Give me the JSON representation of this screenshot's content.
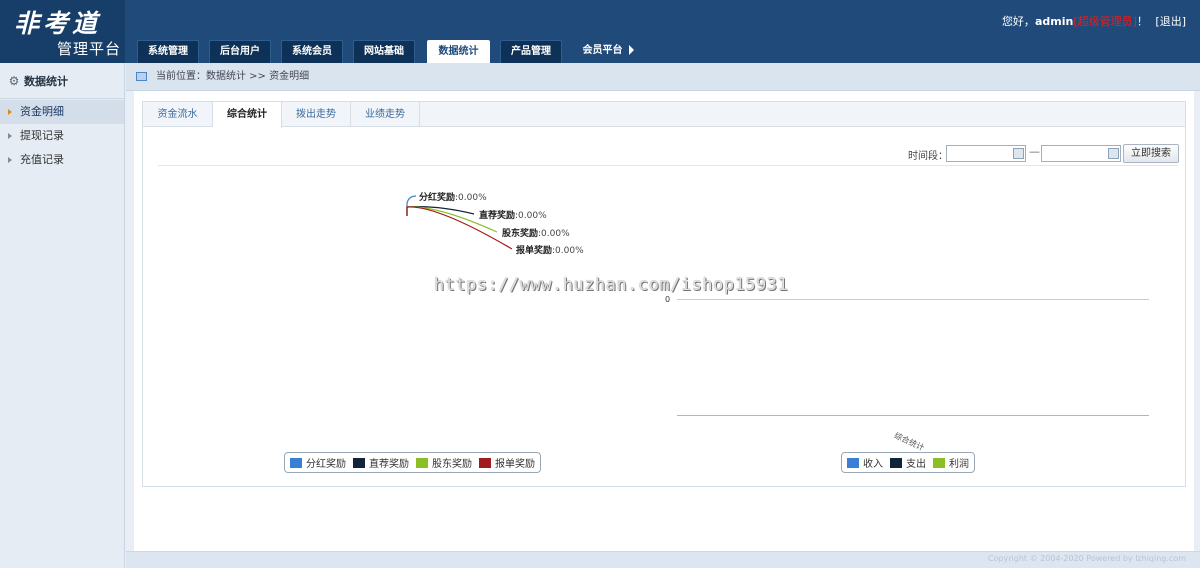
{
  "header": {
    "logo_line1": "非考道",
    "logo_line2": "管理平台",
    "greeting": "您好，",
    "username": "admin",
    "role": "[超级管理员]",
    "exclaim": "！",
    "logout": "[退出]"
  },
  "nav": {
    "tabs": [
      {
        "label": "系统管理"
      },
      {
        "label": "后台用户"
      },
      {
        "label": "系统会员"
      },
      {
        "label": "网站基础"
      },
      {
        "label": "数据统计"
      },
      {
        "label": "产品管理"
      },
      {
        "label": "会员平台"
      }
    ],
    "active_index": 4
  },
  "sidebar": {
    "title": "数据统计",
    "items": [
      {
        "label": "资金明细"
      },
      {
        "label": "提现记录"
      },
      {
        "label": "充值记录"
      }
    ],
    "active_index": 0
  },
  "breadcrumb": "当前位置：数据统计 >> 资金明细",
  "tabs": [
    {
      "label": "资金流水"
    },
    {
      "label": "综合统计"
    },
    {
      "label": "拨出走势"
    },
    {
      "label": "业绩走势"
    }
  ],
  "active_tab": 1,
  "search": {
    "label": "时间段：",
    "start_value": "",
    "end_value": "",
    "separator": "—",
    "button": "立即搜索"
  },
  "watermark": "https://www.huzhan.com/ishop15931",
  "footer": "Copyright © 2004-2020 Powered by lzhiqing.com",
  "chart_data": [
    {
      "type": "pie",
      "labels": [
        "分红奖励",
        "直荐奖励",
        "股东奖励",
        "报单奖励"
      ],
      "values": [
        0,
        0,
        0,
        0
      ],
      "value_labels": [
        "0.00%",
        "0.00%",
        "0.00%",
        "0.00%"
      ],
      "colors": [
        "#3a7fd5",
        "#122538",
        "#8cbf26",
        "#a11c1c"
      ],
      "legend": "bottom"
    },
    {
      "type": "bar",
      "categories": [
        "综合统计"
      ],
      "series": [
        {
          "name": "收入",
          "values": [
            0
          ]
        },
        {
          "name": "支出",
          "values": [
            0
          ]
        },
        {
          "name": "利润",
          "values": [
            0
          ]
        }
      ],
      "colors": [
        "#3a7fd5",
        "#122538",
        "#8cbf26"
      ],
      "y_tick_labels": [
        "0"
      ],
      "legend": "bottom"
    }
  ]
}
